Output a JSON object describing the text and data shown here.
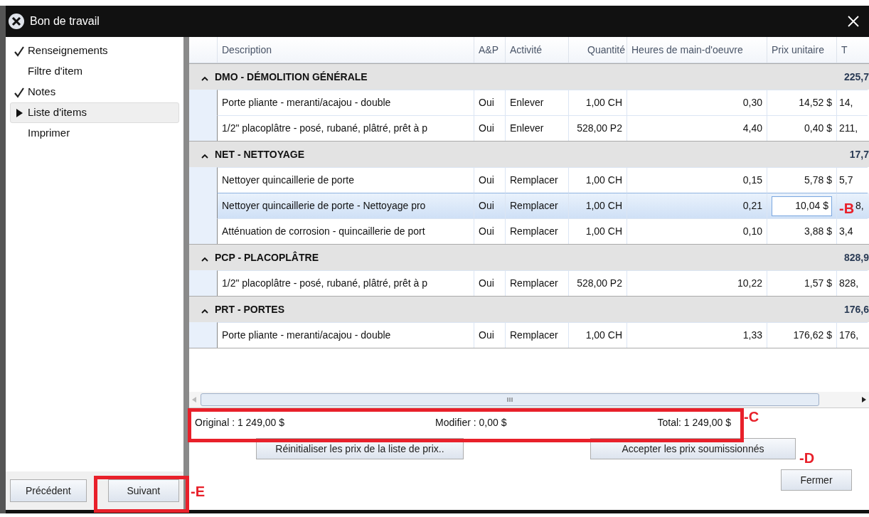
{
  "window": {
    "title": "Bon de travail"
  },
  "sidebar": {
    "items": [
      {
        "label": "Renseignements",
        "checked": true,
        "selected": false
      },
      {
        "label": "Filtre d'item",
        "checked": false,
        "selected": false
      },
      {
        "label": "Notes",
        "checked": true,
        "selected": false
      },
      {
        "label": "Liste d'items",
        "checked": false,
        "selected": true
      },
      {
        "label": "Imprimer",
        "checked": false,
        "selected": false
      }
    ]
  },
  "table": {
    "columns": [
      "Description",
      "A&P",
      "Activité",
      "Quantité",
      "Heures de main-d'oeuvre",
      "Prix unitaire",
      "T"
    ],
    "groups": [
      {
        "label": "DMO - DÉMOLITION GÉNÉRALE",
        "total": "225,7",
        "expanded": true,
        "rows": [
          {
            "cells": [
              "Porte pliante - meranti/acajou - double",
              "Oui",
              "Enlever",
              "1,00 CH",
              "0,30",
              "14,52 $",
              "14,"
            ],
            "selected": false,
            "editing": false
          },
          {
            "cells": [
              "1/2\" placoplâtre - posé, rubané, plâtré, prêt à p",
              "Oui",
              "Enlever",
              "528,00 P2",
              "4,40",
              "0,40 $",
              "211,"
            ],
            "selected": false,
            "editing": false
          }
        ]
      },
      {
        "label": "NET - NETTOYAGE",
        "total": "17,7",
        "expanded": true,
        "rows": [
          {
            "cells": [
              "Nettoyer quincaillerie de porte",
              "Oui",
              "Remplacer",
              "1,00 CH",
              "0,15",
              "5,78 $",
              "5,7"
            ],
            "selected": false,
            "editing": false
          },
          {
            "cells": [
              "Nettoyer quincaillerie de porte - Nettoyage pro",
              "Oui",
              "Remplacer",
              "1,00 CH",
              "0,21",
              "10,04 $",
              "8,"
            ],
            "selected": true,
            "editing": true
          },
          {
            "cells": [
              "Atténuation de corrosion - quincaillerie de port",
              "Oui",
              "Remplacer",
              "1,00 CH",
              "0,10",
              "3,88 $",
              "3,4"
            ],
            "selected": false,
            "editing": false
          }
        ]
      },
      {
        "label": "PCP - PLACOPLÂTRE",
        "total": "828,9",
        "expanded": true,
        "rows": [
          {
            "cells": [
              "1/2\" placoplâtre - posé, rubané, plâtré, prêt à p",
              "Oui",
              "Remplacer",
              "528,00 P2",
              "10,22",
              "1,57 $",
              "828,"
            ],
            "selected": false,
            "editing": false
          }
        ]
      },
      {
        "label": "PRT - PORTES",
        "total": "176,6",
        "expanded": true,
        "rows": [
          {
            "cells": [
              "Porte pliante - meranti/acajou - double",
              "Oui",
              "Remplacer",
              "1,00 CH",
              "1,33",
              "176,62 $",
              "176,"
            ],
            "selected": false,
            "editing": false
          }
        ]
      }
    ]
  },
  "totals": {
    "original": "Original : 1 249,00 $",
    "modifier": "Modifier : 0,00 $",
    "total": "Total: 1 249,00 $"
  },
  "buttons": {
    "reset": "Réinitialiser les prix de la liste de prix..",
    "accept": "Accepter les prix soumissionnés",
    "previous": "Précédent",
    "next": "Suivant",
    "close": "Fermer"
  },
  "annotations": [
    {
      "label": "-B"
    },
    {
      "label": "-C"
    },
    {
      "label": "-D"
    },
    {
      "label": "-E"
    }
  ]
}
